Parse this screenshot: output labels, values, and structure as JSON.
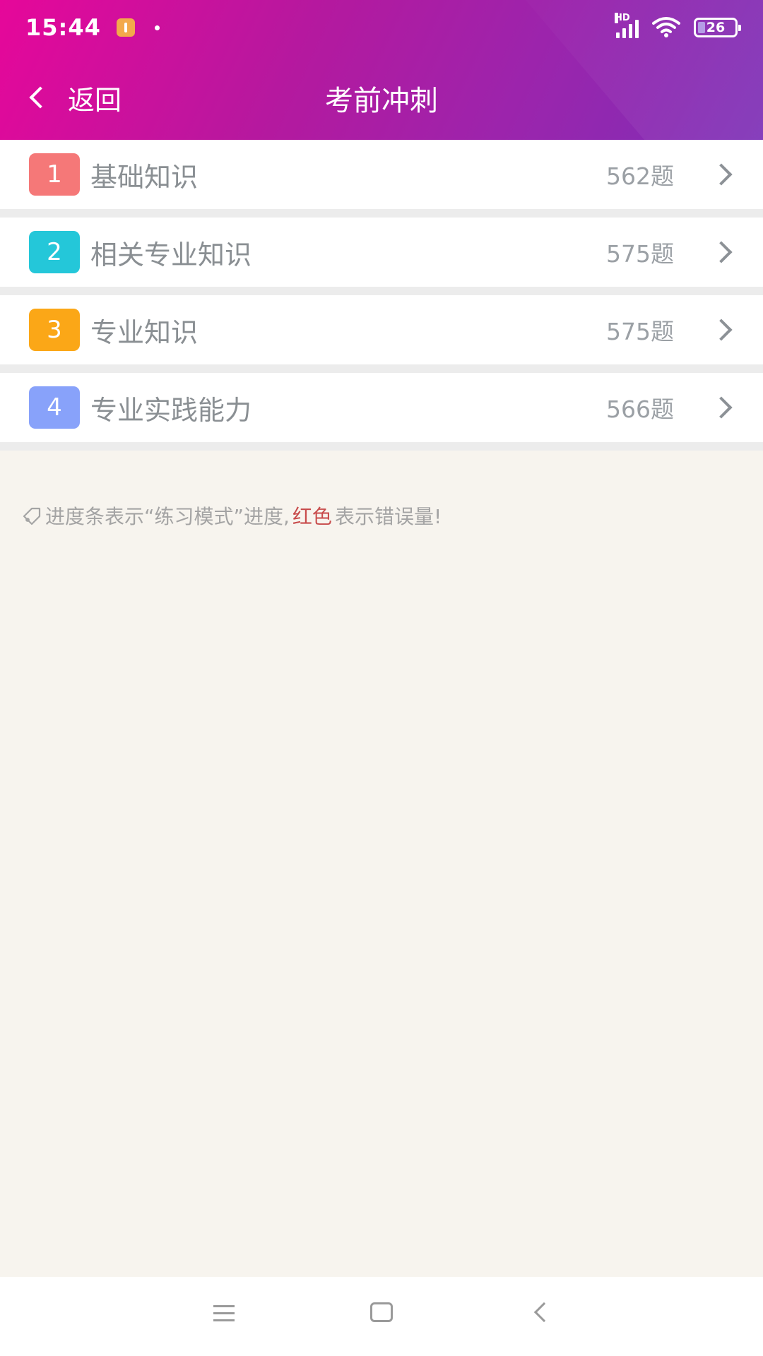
{
  "status": {
    "time": "15:44",
    "network": "HD",
    "battery": "26"
  },
  "nav": {
    "back_label": "返回",
    "title": "考前冲刺"
  },
  "items": [
    {
      "num": "1",
      "label": "基础知识",
      "count": "562题",
      "color": "#f57878"
    },
    {
      "num": "2",
      "label": "相关专业知识",
      "count": "575题",
      "color": "#24c7d9"
    },
    {
      "num": "3",
      "label": "专业知识",
      "count": "575题",
      "color": "#fba717"
    },
    {
      "num": "4",
      "label": "专业实践能力",
      "count": "566题",
      "color": "#88a2fa"
    }
  ],
  "hint": {
    "part1": "进度条表示“练习模式”进度,",
    "red": "红色",
    "part2": "表示错误量!"
  },
  "colors": {
    "header_start": "#e6079a",
    "header_end": "#7c2fb6",
    "background": "#f7f4ee",
    "hint_red": "#c84c4c"
  }
}
